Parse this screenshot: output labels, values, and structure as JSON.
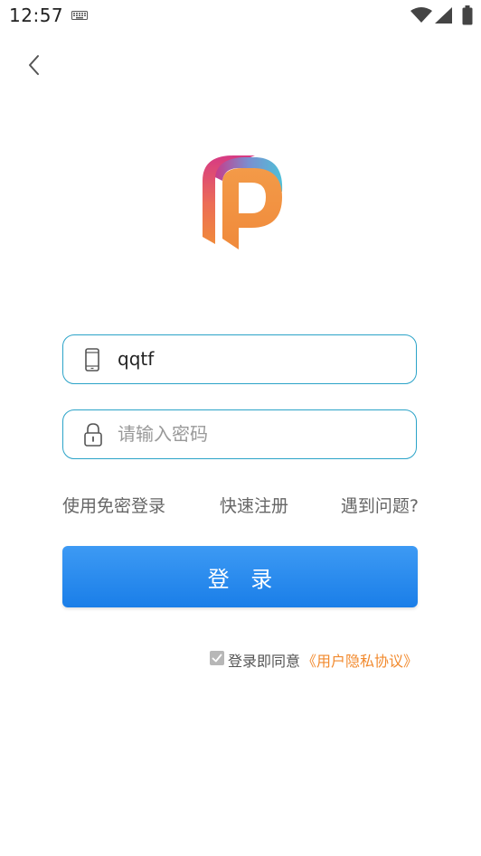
{
  "status_bar": {
    "time": "12:57"
  },
  "login": {
    "phone_value": "qqtf",
    "password_placeholder": "请输入密码",
    "passwordless_link": "使用免密登录",
    "register_link": "快速注册",
    "help_link": "遇到问题?",
    "login_button": "登 录",
    "agree_text": "登录即同意",
    "privacy_link": "《用户隐私协议》"
  },
  "colors": {
    "accent_blue": "#1a7ee8",
    "field_border": "#2ba3c8",
    "privacy_link": "#f28a2e"
  },
  "icons": [
    "keyboard-icon",
    "wifi-icon",
    "signal-icon",
    "battery-icon",
    "back-arrow-icon",
    "app-logo",
    "phone-icon",
    "lock-icon",
    "check-icon"
  ]
}
